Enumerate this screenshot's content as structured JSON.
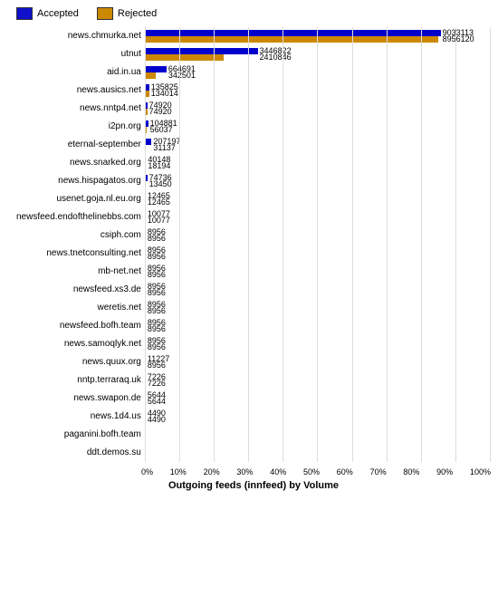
{
  "legend": {
    "accepted_label": "Accepted",
    "rejected_label": "Rejected",
    "accepted_color": "#1111cc",
    "rejected_color": "#cc8800"
  },
  "x_axis": {
    "title": "Outgoing feeds (innfeed) by Volume",
    "labels": [
      "0%",
      "10%",
      "20%",
      "30%",
      "40%",
      "50%",
      "60%",
      "70%",
      "80%",
      "90%",
      "100%"
    ]
  },
  "max_value": 9400000,
  "rows": [
    {
      "label": "news.chmurka.net",
      "accepted": 9033113,
      "rejected": 8956120
    },
    {
      "label": "utnut",
      "accepted": 3446822,
      "rejected": 2410846
    },
    {
      "label": "aid.in.ua",
      "accepted": 664691,
      "rejected": 342501
    },
    {
      "label": "news.ausics.net",
      "accepted": 135825,
      "rejected": 134014
    },
    {
      "label": "news.nntp4.net",
      "accepted": 74920,
      "rejected": 74920
    },
    {
      "label": "i2pn.org",
      "accepted": 104881,
      "rejected": 56037
    },
    {
      "label": "eternal-september",
      "accepted": 207197,
      "rejected": 31137
    },
    {
      "label": "news.snarked.org",
      "accepted": 40148,
      "rejected": 18194
    },
    {
      "label": "news.hispagatos.org",
      "accepted": 74736,
      "rejected": 13450
    },
    {
      "label": "usenet.goja.nl.eu.org",
      "accepted": 12465,
      "rejected": 12465
    },
    {
      "label": "newsfeed.endofthelinebbs.com",
      "accepted": 10077,
      "rejected": 10077
    },
    {
      "label": "csiph.com",
      "accepted": 8956,
      "rejected": 8956
    },
    {
      "label": "news.tnetconsulting.net",
      "accepted": 8956,
      "rejected": 8956
    },
    {
      "label": "mb-net.net",
      "accepted": 8956,
      "rejected": 8956
    },
    {
      "label": "newsfeed.xs3.de",
      "accepted": 8956,
      "rejected": 8956
    },
    {
      "label": "weretis.net",
      "accepted": 8956,
      "rejected": 8956
    },
    {
      "label": "newsfeed.bofh.team",
      "accepted": 8956,
      "rejected": 8956
    },
    {
      "label": "news.samoqlyk.net",
      "accepted": 8956,
      "rejected": 8956
    },
    {
      "label": "news.quux.org",
      "accepted": 11227,
      "rejected": 8956
    },
    {
      "label": "nntp.terraraq.uk",
      "accepted": 7226,
      "rejected": 7226
    },
    {
      "label": "news.swapon.de",
      "accepted": 5644,
      "rejected": 5644
    },
    {
      "label": "news.1d4.us",
      "accepted": 4490,
      "rejected": 4490
    },
    {
      "label": "paganini.bofh.team",
      "accepted": 0,
      "rejected": 0
    },
    {
      "label": "ddt.demos.su",
      "accepted": 0,
      "rejected": 0
    }
  ]
}
